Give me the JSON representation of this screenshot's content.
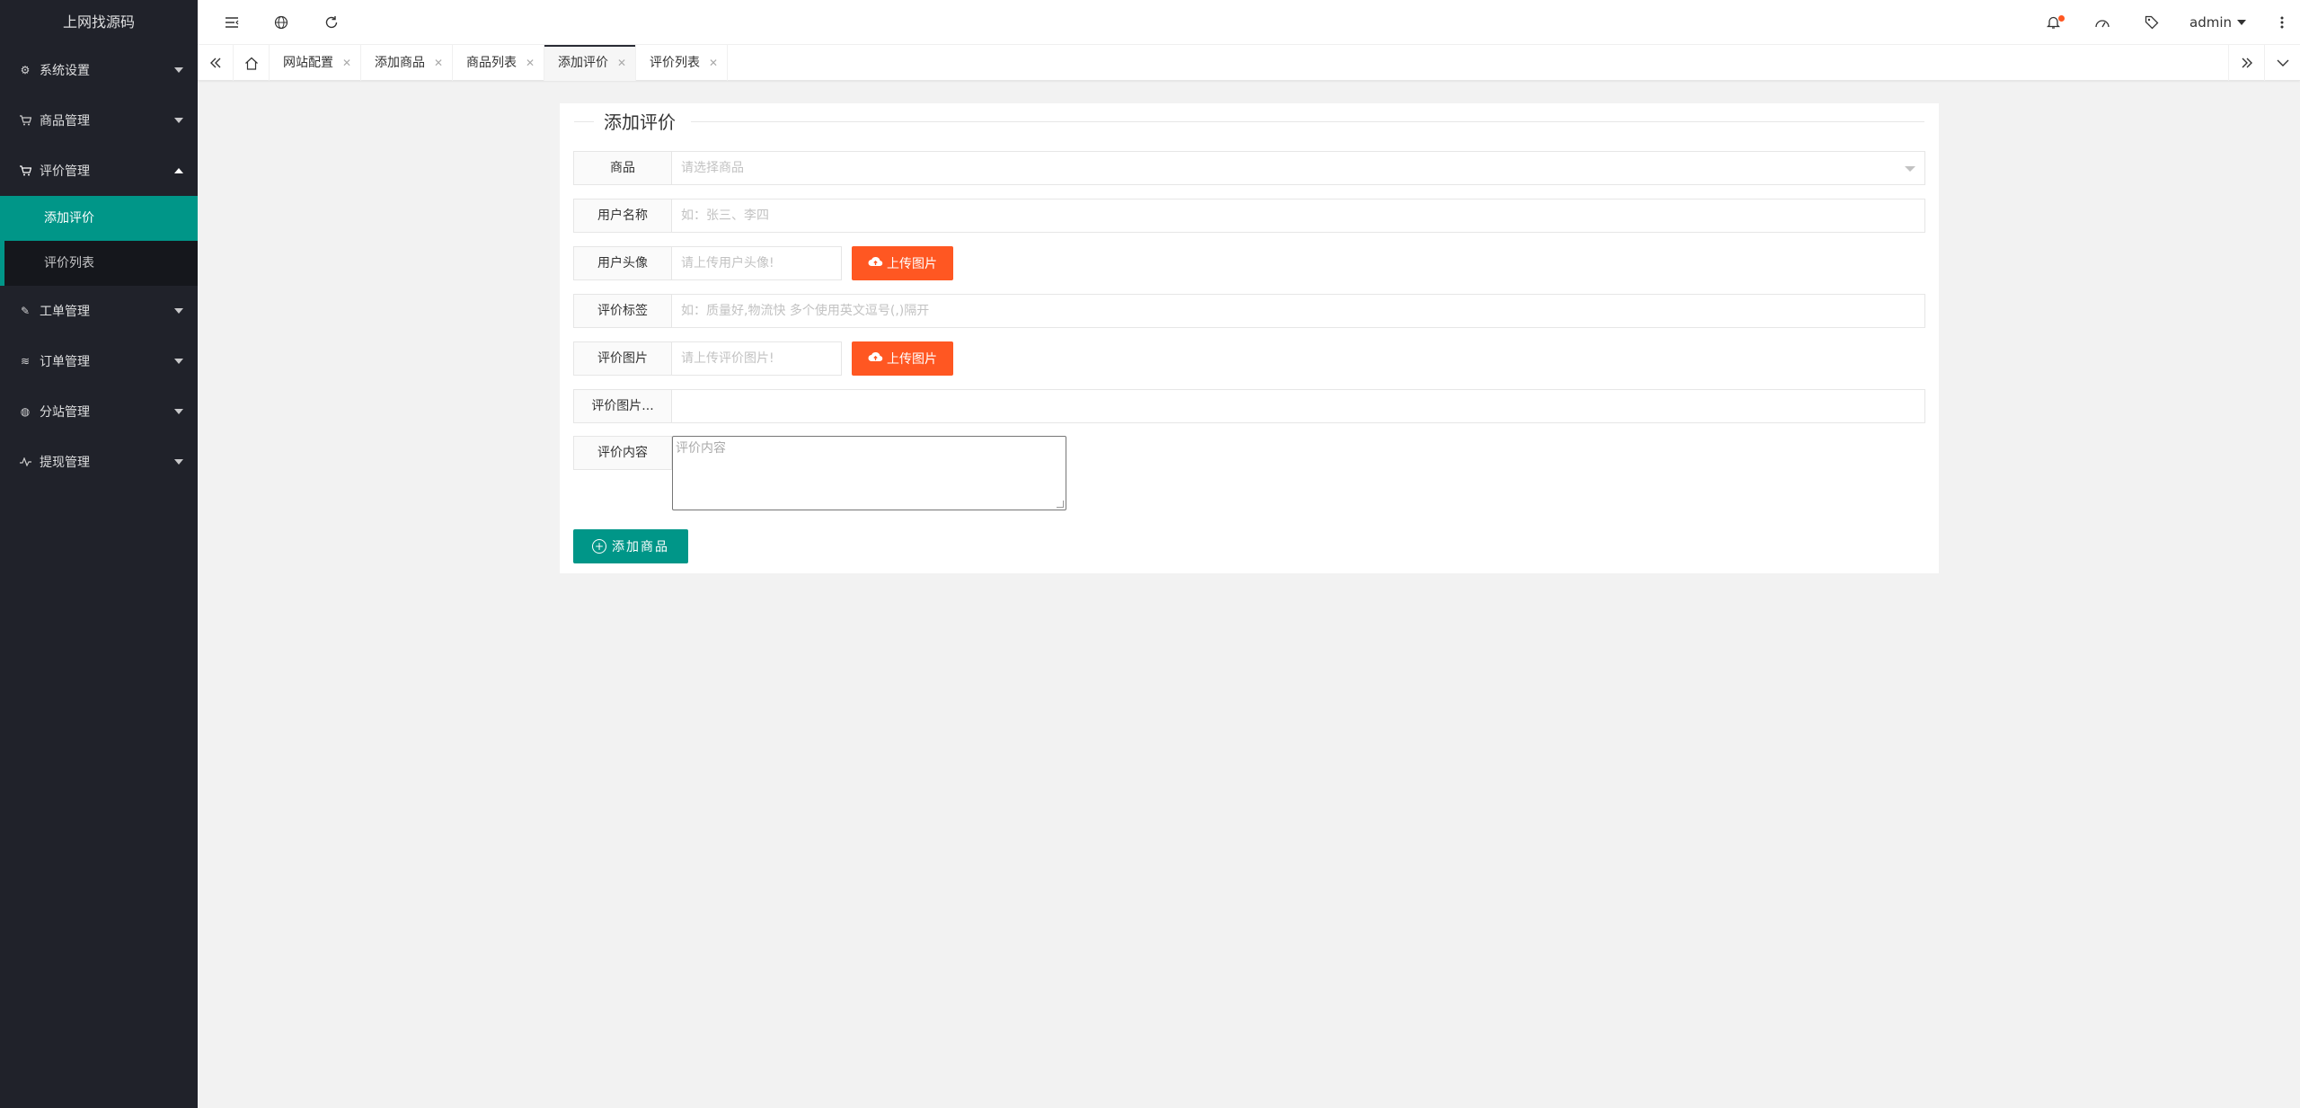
{
  "brand": {
    "title": "上网找源码"
  },
  "sidebar": {
    "items": [
      {
        "label": "系统设置",
        "icon": "gear-icon"
      },
      {
        "label": "商品管理",
        "icon": "cart-icon"
      },
      {
        "label": "评价管理",
        "icon": "cart-icon",
        "expanded": true,
        "children": [
          {
            "label": "添加评价",
            "active": true
          },
          {
            "label": "评价列表"
          }
        ]
      },
      {
        "label": "工单管理",
        "icon": "edit-icon"
      },
      {
        "label": "订单管理",
        "icon": "layers-icon"
      },
      {
        "label": "分站管理",
        "icon": "globe-icon"
      },
      {
        "label": "提现管理",
        "icon": "pulse-icon"
      }
    ]
  },
  "header": {
    "icons": [
      "menu-toggle-icon",
      "globe-icon",
      "refresh-icon",
      "bell-icon",
      "theme-icon",
      "tag-icon",
      "more-icon"
    ],
    "user": "admin"
  },
  "tabs": {
    "items": [
      {
        "label": "网站配置"
      },
      {
        "label": "添加商品"
      },
      {
        "label": "商品列表"
      },
      {
        "label": "添加评价",
        "active": true
      },
      {
        "label": "评价列表"
      }
    ]
  },
  "form": {
    "title": "添加评价",
    "product": {
      "label": "商品",
      "placeholder": "请选择商品"
    },
    "username": {
      "label": "用户名称",
      "placeholder": "如：张三、李四"
    },
    "avatar": {
      "label": "用户头像",
      "placeholder": "请上传用户头像!",
      "upload_label": "上传图片"
    },
    "tags": {
      "label": "评价标签",
      "placeholder": "如：质量好,物流快 多个使用英文逗号(,)隔开"
    },
    "images": {
      "label": "评价图片",
      "placeholder": "请上传评价图片!",
      "upload_label": "上传图片"
    },
    "images_extra": {
      "label": "评价图片...",
      "value": ""
    },
    "content": {
      "label": "评价内容",
      "placeholder": "评价内容"
    },
    "submit_label": "添加商品"
  },
  "colors": {
    "sidebar": "#20222a",
    "accent": "#009688",
    "upload": "#ff5722",
    "notify": "#ff5722"
  }
}
